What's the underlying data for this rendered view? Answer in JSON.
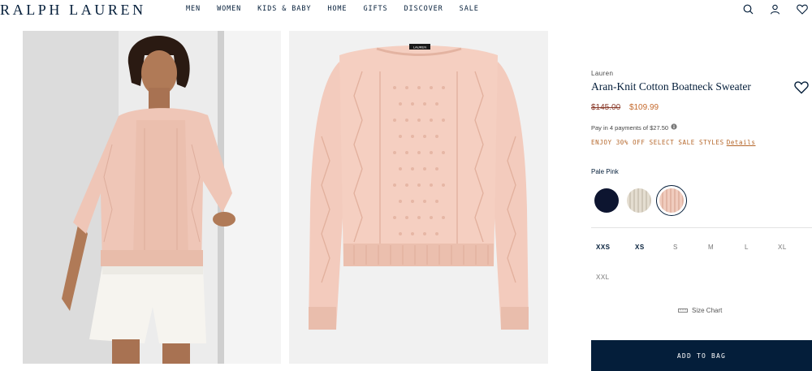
{
  "header": {
    "logo": "RALPH LAUREN",
    "nav": [
      "MEN",
      "WOMEN",
      "KIDS & BABY",
      "HOME",
      "GIFTS",
      "DISCOVER",
      "SALE"
    ],
    "icons": [
      "search-icon",
      "account-icon",
      "wishlist-icon"
    ]
  },
  "gallery": {
    "images": [
      "model-wearing-sweater",
      "sweater-flat-lay"
    ],
    "label_tag": "LAUREN"
  },
  "product": {
    "brand": "Lauren",
    "title": "Aran-Knit Cotton Boatneck Sweater",
    "price_original": "$145.00",
    "price_sale": "$109.99",
    "installments": "Pay in 4 payments of $27.50",
    "promo_text": "ENJOY 30% OFF SELECT SALE STYLES",
    "promo_link": "Details",
    "color_label": "Pale Pink",
    "swatches": [
      {
        "name": "navy",
        "color": "#0d1530"
      },
      {
        "name": "cream",
        "color": "#ddd6c8"
      },
      {
        "name": "pale-pink",
        "color": "#ecc7b8",
        "selected": true
      }
    ],
    "sizes": [
      "XXS",
      "XS",
      "S",
      "M",
      "L",
      "XL",
      "XXL"
    ],
    "size_chart": "Size Chart",
    "add_to_bag": "ADD TO BAG"
  },
  "colors": {
    "navy": "#041e3a",
    "sale": "#c4682b",
    "sweater": "#f1cbbd"
  }
}
